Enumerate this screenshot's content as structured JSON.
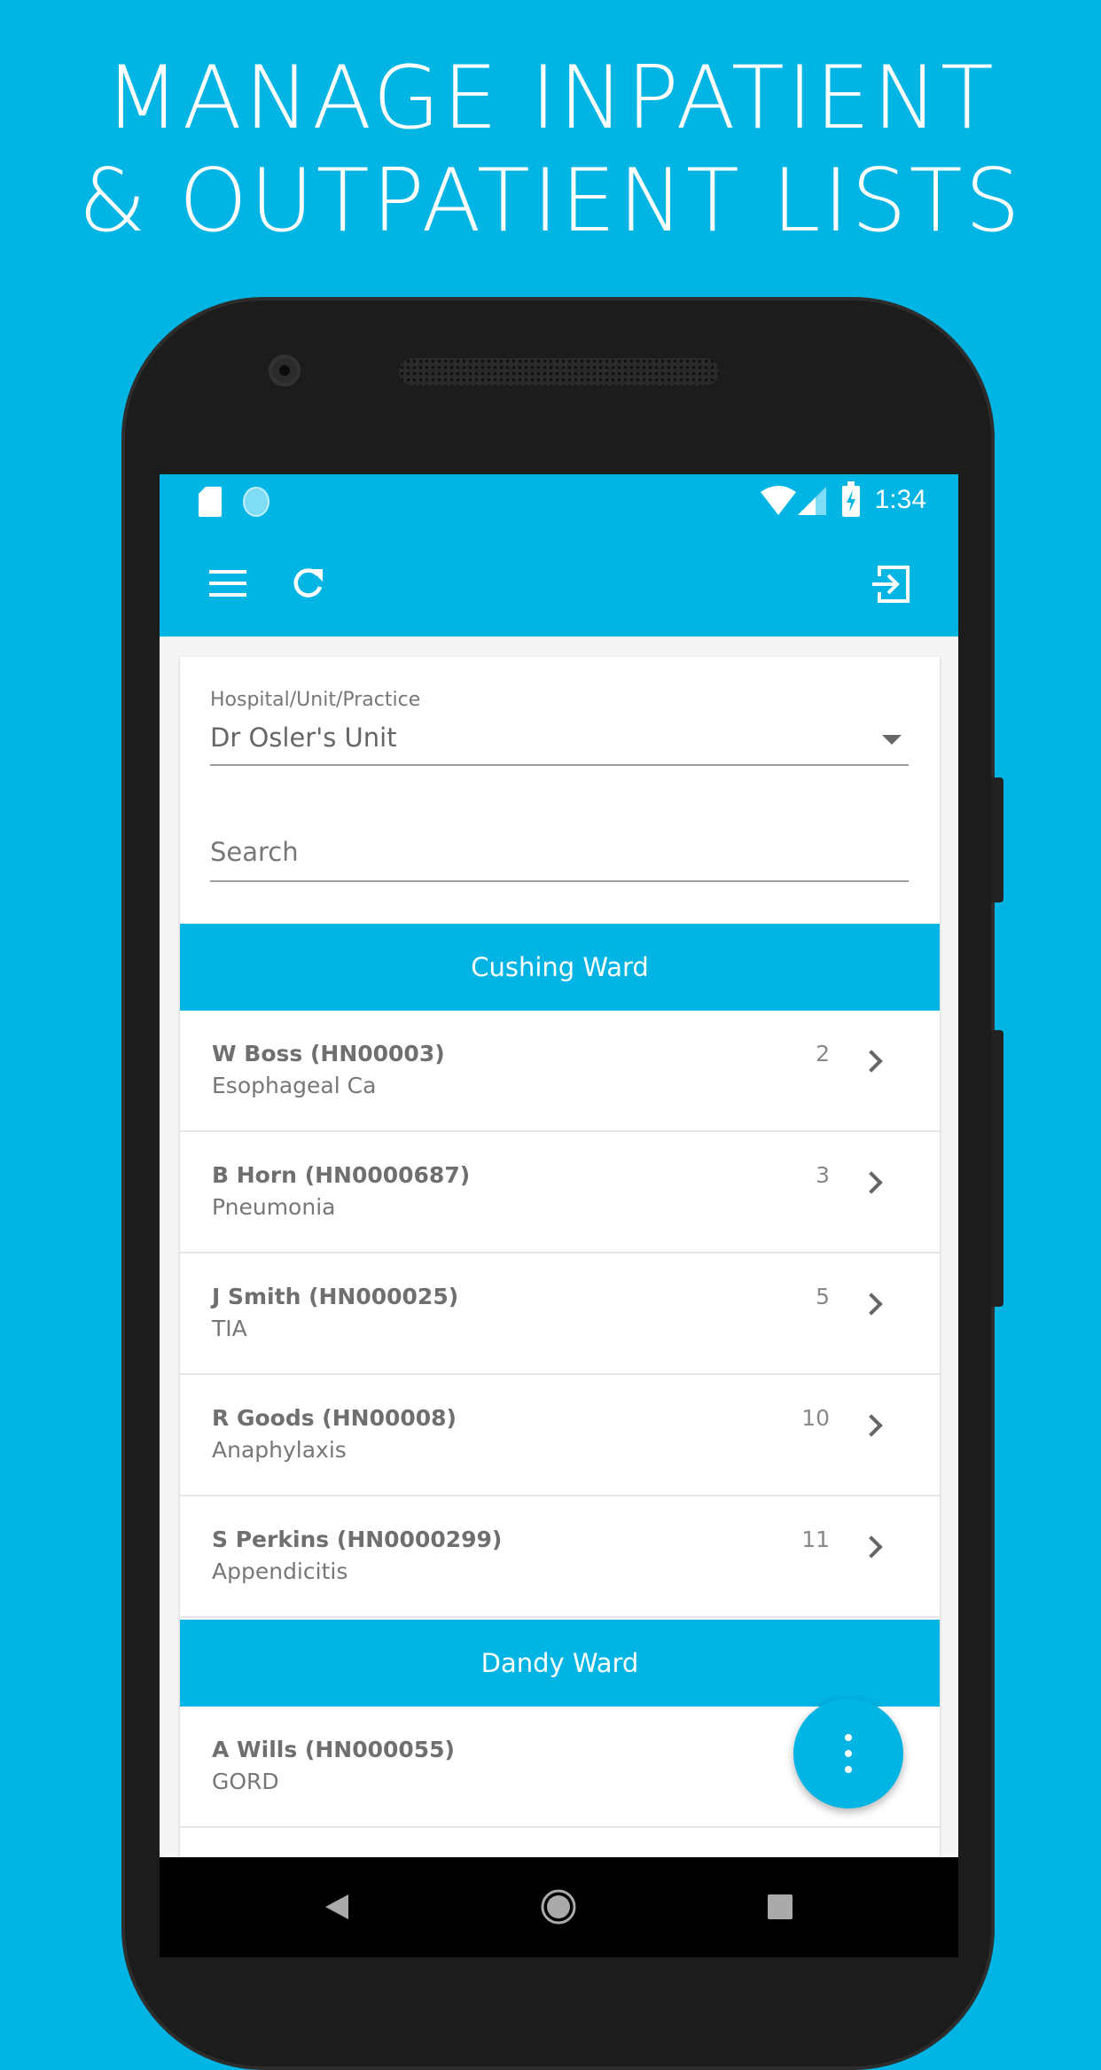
{
  "headline": {
    "line1": "MANAGE INPATIENT",
    "line2": "& OUTPATIENT LISTS"
  },
  "colors": {
    "brand": "#00b4e4",
    "background": "#00b4e4"
  },
  "status_bar": {
    "time": "1:34",
    "icons": [
      "sd-card-icon",
      "sync-icon",
      "wifi-icon",
      "signal-icon",
      "battery-charging-icon"
    ]
  },
  "toolbar": {
    "icons": [
      "menu-icon",
      "refresh-icon",
      "logout-icon"
    ]
  },
  "unit_select": {
    "label": "Hospital/Unit/Practice",
    "value": "Dr Osler's Unit"
  },
  "search": {
    "placeholder": "Search"
  },
  "wards": [
    {
      "name": "Cushing Ward",
      "patients": [
        {
          "name": "W Boss (HN00003)",
          "diagnosis": "Esophageal Ca",
          "bed": "2"
        },
        {
          "name": "B Horn (HN0000687)",
          "diagnosis": "Pneumonia",
          "bed": "3"
        },
        {
          "name": "J Smith (HN000025)",
          "diagnosis": "TIA",
          "bed": "5"
        },
        {
          "name": "R Goods (HN00008)",
          "diagnosis": "Anaphylaxis",
          "bed": "10"
        },
        {
          "name": "S Perkins (HN0000299)",
          "diagnosis": "Appendicitis",
          "bed": "11"
        }
      ]
    },
    {
      "name": "Dandy Ward",
      "patients": [
        {
          "name": "A Wills (HN000055)",
          "diagnosis": "GORD",
          "bed": ""
        }
      ]
    }
  ]
}
